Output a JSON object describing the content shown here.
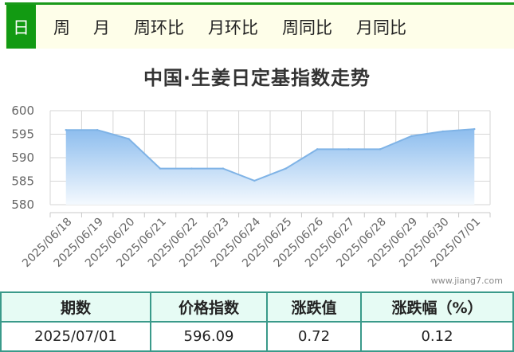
{
  "tabs": [
    {
      "label": "日",
      "active": true
    },
    {
      "label": "周",
      "active": false
    },
    {
      "label": "月",
      "active": false
    },
    {
      "label": "周环比",
      "active": false
    },
    {
      "label": "月环比",
      "active": false
    },
    {
      "label": "周同比",
      "active": false
    },
    {
      "label": "月同比",
      "active": false
    }
  ],
  "chart_data": {
    "type": "area",
    "title": "中国·生姜日定基指数走势",
    "categories": [
      "2025/06/18",
      "2025/06/19",
      "2025/06/20",
      "2025/06/21",
      "2025/06/22",
      "2025/06/23",
      "2025/06/24",
      "2025/06/25",
      "2025/06/26",
      "2025/06/27",
      "2025/06/28",
      "2025/06/29",
      "2025/06/30",
      "2025/07/01"
    ],
    "series": [
      {
        "values": [
          595.9,
          595.9,
          594.0,
          587.7,
          587.7,
          587.7,
          585.1,
          587.7,
          591.8,
          591.8,
          591.8,
          594.6,
          595.6,
          596.09
        ]
      }
    ],
    "yticks": [
      580,
      585,
      590,
      595,
      600
    ],
    "ylim": [
      580,
      600
    ],
    "grid": true,
    "line_color": "#7fb3e6",
    "fill_color_top": "#8dbdee",
    "fill_color_bottom": "#f4f9fe"
  },
  "watermark": "www.jiang7.com",
  "summary": {
    "headers": [
      "期数",
      "价格指数",
      "涨跌值",
      "涨跌幅（%）"
    ],
    "row": [
      "2025/07/01",
      "596.09",
      "0.72",
      "0.12"
    ]
  }
}
